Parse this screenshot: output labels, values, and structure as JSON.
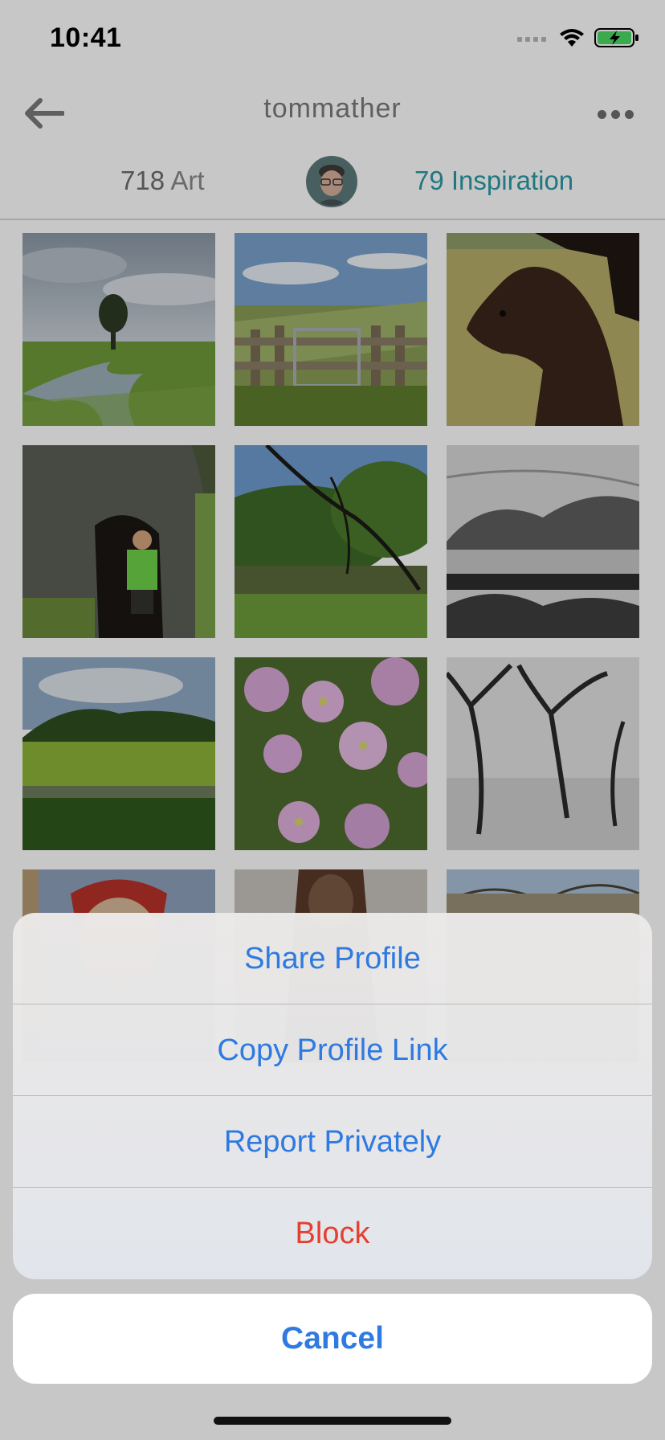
{
  "status_bar": {
    "time": "10:41"
  },
  "nav": {
    "title": "tommather",
    "back_icon": "back-arrow-icon",
    "more_icon": "more-ellipsis-icon"
  },
  "stats": {
    "art_count": "718",
    "art_label": "Art",
    "inspiration_count": "79",
    "inspiration_label": "Inspiration"
  },
  "photos": [
    {
      "subject": "landscape with lone tree and creek"
    },
    {
      "subject": "dike with gate and fence"
    },
    {
      "subject": "dark brown horses in field"
    },
    {
      "subject": "person in hollow tree trunk"
    },
    {
      "subject": "river with hanging branches"
    },
    {
      "subject": "black and white pencil landscape"
    },
    {
      "subject": "green marsh and forest"
    },
    {
      "subject": "pink evening primrose flowers"
    },
    {
      "subject": "black and white pencil trees"
    },
    {
      "subject": "renaissance portrait with red hat"
    },
    {
      "subject": "bearded bust in dark robe"
    },
    {
      "subject": "bare trees against sky"
    }
  ],
  "action_sheet": {
    "items": [
      {
        "label": "Share Profile"
      },
      {
        "label": "Copy Profile Link"
      },
      {
        "label": "Report Privately"
      },
      {
        "label": "Block"
      }
    ],
    "cancel_label": "Cancel"
  },
  "colors": {
    "accent": "#2f7ae0",
    "destructive": "#e5402f",
    "inspiration": "#2b9aa7"
  }
}
